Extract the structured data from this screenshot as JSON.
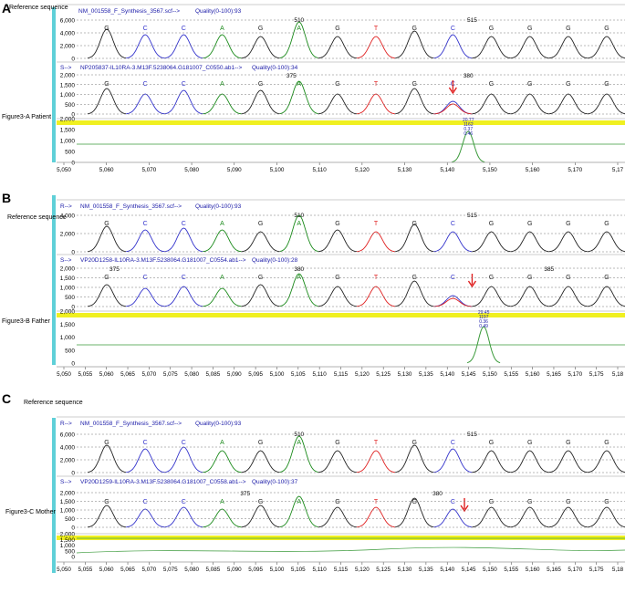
{
  "panels": [
    {
      "letter": "A",
      "ref_label": "Reference sequence",
      "ref_prefix": "",
      "ref_file": "NM_001558_F_Synthesis_3567.scf-->",
      "ref_quality": "Quality(0-100):93",
      "ref_yticks": [
        "6,000",
        "4,000",
        "2,000",
        "0"
      ],
      "ref_bases": [
        "G",
        "C",
        "C",
        "A",
        "G",
        "A",
        "G",
        "T",
        "G",
        "C",
        "G",
        "G",
        "G",
        "G"
      ],
      "ref_pos": [
        {
          "label": "510",
          "at": 5
        },
        {
          "label": "515",
          "at": 9.5
        }
      ],
      "sample_prefix": "S-->",
      "sample_file": "NP205837-IL10RA-3.M13F.5238064.G181007_C0550.ab1-->",
      "sample_quality": "Quality(0-100):34",
      "sample_yticks": [
        "2,000",
        "1,500",
        "1,000",
        "500",
        "0"
      ],
      "sample_bases": [
        "G",
        "C",
        "C",
        "A",
        "G",
        "A",
        "G",
        "T",
        "G",
        "C",
        "G",
        "G",
        "G",
        "G"
      ],
      "sample_pos": [
        {
          "label": "375",
          "at": 4.8
        },
        {
          "label": "380",
          "at": 9.4
        }
      ],
      "fig_label": "Figure3-A Patient",
      "diff_yticks": [
        "2,000",
        "1,500",
        "1,000",
        "500",
        "0"
      ],
      "diff_values": [
        "20.77",
        "1162",
        "0.37",
        "0.46"
      ],
      "xticks": [
        "5,050",
        "5,060",
        "5,070",
        "5,080",
        "5,090",
        "5,100",
        "5,110",
        "5,120",
        "5,130",
        "5,140",
        "5,150",
        "5,160",
        "5,170",
        "5,17"
      ]
    },
    {
      "letter": "B",
      "ref_label": "Reference sequence",
      "ref_prefix": "R-->",
      "ref_file": "NM_001558_F_Synthesis_3567.scf-->",
      "ref_quality": "Quality(0-100):93",
      "ref_yticks": [
        "4,000",
        "2,000",
        "0"
      ],
      "ref_bases": [
        "G",
        "C",
        "C",
        "A",
        "G",
        "A",
        "G",
        "T",
        "G",
        "C",
        "G",
        "G",
        "G",
        "G"
      ],
      "ref_pos": [
        {
          "label": "510",
          "at": 5
        },
        {
          "label": "515",
          "at": 9.5
        }
      ],
      "sample_prefix": "S-->",
      "sample_file": "VP20D1258-IL10RA-3.M13F.5238064.G181007_C0554.ab1-->",
      "sample_quality": "Quality(0-100):28",
      "sample_yticks": [
        "2,000",
        "1,500",
        "1,000",
        "500",
        "0"
      ],
      "sample_bases": [
        "G",
        "C",
        "C",
        "A",
        "G",
        "A",
        "G",
        "T",
        "G",
        "C",
        "G",
        "G",
        "G",
        "G"
      ],
      "sample_pos": [
        {
          "label": "375",
          "at": 0.2
        },
        {
          "label": "380",
          "at": 5
        },
        {
          "label": "385",
          "at": 11.5
        }
      ],
      "fig_label": "Figure3-B Father",
      "diff_yticks": [
        "2,000",
        "1,500",
        "1,000",
        "500",
        "0"
      ],
      "diff_values": [
        "29.45",
        "1197",
        "0.36",
        "0.49"
      ],
      "xticks": [
        "5,050",
        "5,055",
        "5,060",
        "5,065",
        "5,070",
        "5,075",
        "5,080",
        "5,085",
        "5,090",
        "5,095",
        "5,100",
        "5,105",
        "5,110",
        "5,115",
        "5,120",
        "5,125",
        "5,130",
        "5,135",
        "5,140",
        "5,145",
        "5,150",
        "5,155",
        "5,160",
        "5,165",
        "5,170",
        "5,175",
        "5,18"
      ]
    },
    {
      "letter": "C",
      "ref_label": "Reference sequence",
      "ref_prefix": "R-->",
      "ref_file": "NM_001558_F_Synthesis_3567.scf-->",
      "ref_quality": "Quality(0-100):93",
      "ref_yticks": [
        "6,000",
        "4,000",
        "2,000",
        "0"
      ],
      "ref_bases": [
        "G",
        "C",
        "C",
        "A",
        "G",
        "A",
        "G",
        "T",
        "G",
        "C",
        "G",
        "G",
        "G",
        "G"
      ],
      "ref_pos": [
        {
          "label": "510",
          "at": 5
        },
        {
          "label": "515",
          "at": 9.5
        }
      ],
      "sample_prefix": "S-->",
      "sample_file": "VP20D1259-IL10RA-3.M13F.5238064.G181007_C0558.ab1-->",
      "sample_quality": "Quality(0-100):37",
      "sample_yticks": [
        "2,000",
        "1,500",
        "1,000",
        "500",
        "0"
      ],
      "sample_bases": [
        "G",
        "C",
        "C",
        "A",
        "G",
        "A",
        "G",
        "T",
        "G",
        "C",
        "G",
        "G",
        "G",
        "G"
      ],
      "sample_pos": [
        {
          "label": "375",
          "at": 3.6
        },
        {
          "label": "380",
          "at": 8.6
        }
      ],
      "fig_label": "Figure3-C Mother",
      "diff_yticks": [
        "2,000",
        "1,500",
        "1,000",
        "500",
        "0"
      ],
      "diff_values": [],
      "xticks": [
        "5,050",
        "5,055",
        "5,060",
        "5,065",
        "5,070",
        "5,075",
        "5,080",
        "5,085",
        "5,090",
        "5,095",
        "5,100",
        "5,105",
        "5,110",
        "5,115",
        "5,120",
        "5,125",
        "5,130",
        "5,135",
        "5,140",
        "5,145",
        "5,150",
        "5,155",
        "5,160",
        "5,165",
        "5,170",
        "5,175",
        "5,18"
      ]
    }
  ],
  "colors": {
    "G": "#222222",
    "C": "#3333cc",
    "A": "#1a8a1a",
    "T": "#e02020",
    "label_blue": "#1a1aa8",
    "teal_bar": "#5fd0d8",
    "yellow_band": "#f0f020",
    "diff_green": "#3a9a3a",
    "arrow": "#e02020"
  }
}
